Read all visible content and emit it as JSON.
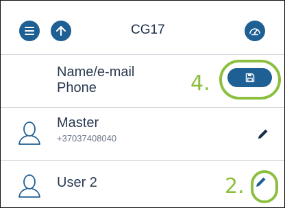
{
  "header": {
    "title": "CG17",
    "menu_icon": "menu-icon",
    "up_icon": "arrow-up-icon",
    "gauge_icon": "gauge-icon",
    "accent_color": "#1e5f94"
  },
  "columns": {
    "name_label": "Name/e-mail",
    "phone_label": "Phone",
    "save_icon": "save-icon"
  },
  "annotations": {
    "step_save": "4.",
    "step_edit": "2.",
    "highlight_color": "#8cbf3f"
  },
  "users": [
    {
      "name": "Master",
      "phone": "+37037408040",
      "avatar_icon": "user-icon",
      "edit_icon": "pencil-icon"
    },
    {
      "name": "User 2",
      "phone": "",
      "avatar_icon": "user-icon",
      "edit_icon": "pencil-icon"
    }
  ]
}
